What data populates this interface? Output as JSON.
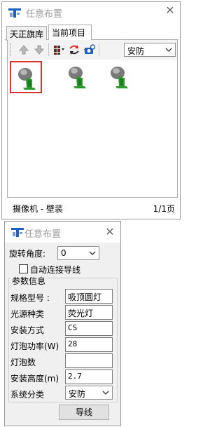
{
  "panel1": {
    "title": "任意布置",
    "tabs": [
      {
        "label": "天正旗库",
        "active": false
      },
      {
        "label": "当前项目",
        "active": true
      }
    ],
    "toolbar": {
      "buttons": [
        "up-arrow-icon",
        "down-arrow-icon",
        "grid-icon",
        "swap-icon",
        "camera-icon"
      ],
      "category_value": "安防"
    },
    "items": [
      {
        "icon": "camera-icon",
        "selected": true
      },
      {
        "icon": "camera-icon",
        "selected": false
      },
      {
        "icon": "camera-icon",
        "selected": false
      }
    ],
    "status": {
      "name": "摄像机 - 壁装",
      "page": "1/1页"
    }
  },
  "panel2": {
    "title": "任意布置",
    "rotation_label": "旋转角度:",
    "rotation_value": "0",
    "auto_connect_label": "自动连接导线",
    "auto_connect_checked": false,
    "params_title": "参数信息",
    "params": [
      {
        "label": "规格型号 :",
        "value": "吸顶圆灯"
      },
      {
        "label": "光源种类",
        "value": "荧光灯"
      },
      {
        "label": "安装方式",
        "value": "CS"
      },
      {
        "label": "灯泡功率(W)",
        "value": "28"
      },
      {
        "label": "灯泡数",
        "value": ""
      },
      {
        "label": "安装高度(m)",
        "value": "2.7"
      }
    ],
    "system_label": "系统分类",
    "system_value": "安防",
    "wire_button": "导线"
  },
  "colors": {
    "accent_blue": "#1f5fbf",
    "selection_red": "#d93535",
    "camera_green": "#2f9a2f"
  }
}
